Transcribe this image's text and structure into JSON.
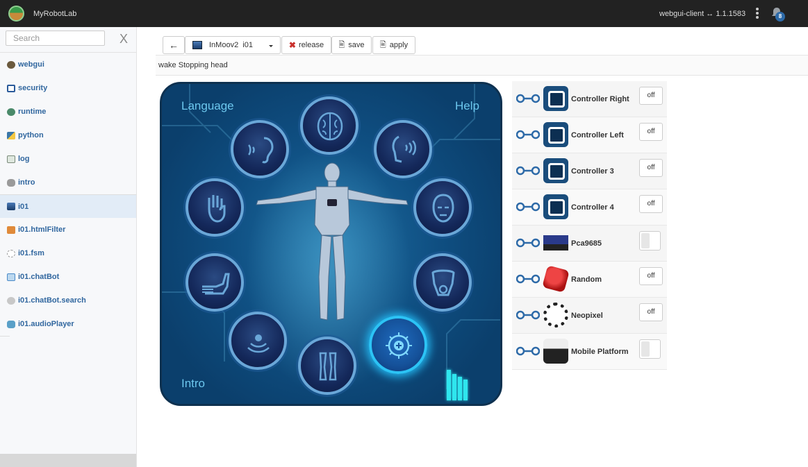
{
  "header": {
    "brand": "MyRobotLab",
    "client": "webgui-client ↔ 1.1.1583",
    "notification_count": "8",
    "accent": "#2d6aa8"
  },
  "sidebar": {
    "search_placeholder": "Search",
    "close_label": "X",
    "items": [
      {
        "label": "webgui",
        "icon": "webgui-icon",
        "color": "#6b5a3e"
      },
      {
        "label": "security",
        "icon": "security-icon",
        "color": "#2a5a9a"
      },
      {
        "label": "runtime",
        "icon": "runtime-icon",
        "color": "#4a8a6a"
      },
      {
        "label": "python",
        "icon": "python-icon",
        "color": "#3b77a8"
      },
      {
        "label": "log",
        "icon": "log-icon",
        "color": "#7a8a7a"
      },
      {
        "label": "intro",
        "icon": "intro-icon",
        "color": "#7a7a7a"
      },
      {
        "label": "i01",
        "icon": "inmoov-icon",
        "color": "#1b3d6a"
      },
      {
        "label": "i01.htmlFilter",
        "icon": "htmlfilter-icon",
        "color": "#e08a3a"
      },
      {
        "label": "i01.fsm",
        "icon": "fsm-icon",
        "color": "#9a9a9a"
      },
      {
        "label": "i01.chatBot",
        "icon": "chatbot-icon",
        "color": "#4a8ac8"
      },
      {
        "label": "i01.chatBot.search",
        "icon": "search-service-icon",
        "color": "#a0a0a0"
      },
      {
        "label": "i01.audioPlayer",
        "icon": "audio-player-icon",
        "color": "#5aa0c8"
      }
    ]
  },
  "toolbar": {
    "back": "←",
    "service_select": "InMoov2  i01",
    "release": "release",
    "save": "save",
    "apply": "apply"
  },
  "status": "wake Stopping head",
  "panel": {
    "language": "Language",
    "help": "Help",
    "intro": "Intro",
    "circles": [
      "ear-icon",
      "brain-icon",
      "speech-icon",
      "hand-icon",
      "head-icon",
      "arm-icon",
      "torso-icon",
      "servo-mixer-icon",
      "legs-icon",
      "add-service-icon"
    ]
  },
  "controllers": [
    {
      "label": "Controller Right",
      "control": "off",
      "kind": "button"
    },
    {
      "label": "Controller Left",
      "control": "off",
      "kind": "button"
    },
    {
      "label": "Controller 3",
      "control": "off",
      "kind": "button"
    },
    {
      "label": "Controller 4",
      "control": "off",
      "kind": "button"
    },
    {
      "label": "Pca9685",
      "control": "",
      "kind": "toggle"
    },
    {
      "label": "Random",
      "control": "off",
      "kind": "button"
    },
    {
      "label": "Neopixel",
      "control": "off",
      "kind": "button"
    },
    {
      "label": "Mobile Platform",
      "control": "",
      "kind": "toggle"
    }
  ]
}
